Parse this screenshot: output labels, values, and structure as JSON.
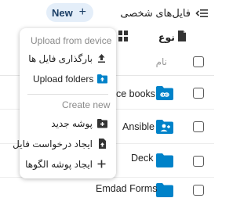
{
  "header": {
    "title": "فایل‌های شخصی",
    "new_label": "New",
    "new_icon": "plus-icon",
    "menu_icon": "menu-collapse-icon"
  },
  "toolbar": {
    "sort_label": "نوع",
    "sort_icon": "sort-icon",
    "view_icon": "view-toggle-icon"
  },
  "table": {
    "column_name": "نام",
    "rows": [
      {
        "name": "ce books",
        "icon": "link-folder-icon"
      },
      {
        "name": "Ansible",
        "icon": "shared-folder-icon"
      },
      {
        "name": "Deck",
        "icon": "folder-icon"
      },
      {
        "name": "Emdad Forms",
        "icon": "folder-icon"
      }
    ]
  },
  "menu": {
    "section_upload": "Upload from device",
    "upload_files": "بارگذاری فایل ها",
    "upload_folders": "Upload folders",
    "section_create": "Create new",
    "new_folder": "پوشه جدید",
    "file_request": "ایجاد درخواست فایل",
    "templates_folder": "ایجاد پوشه الگوها"
  },
  "colors": {
    "accent": "#0082c9",
    "new_button_bg": "#e4eef9",
    "new_button_text": "#1c3f66"
  }
}
